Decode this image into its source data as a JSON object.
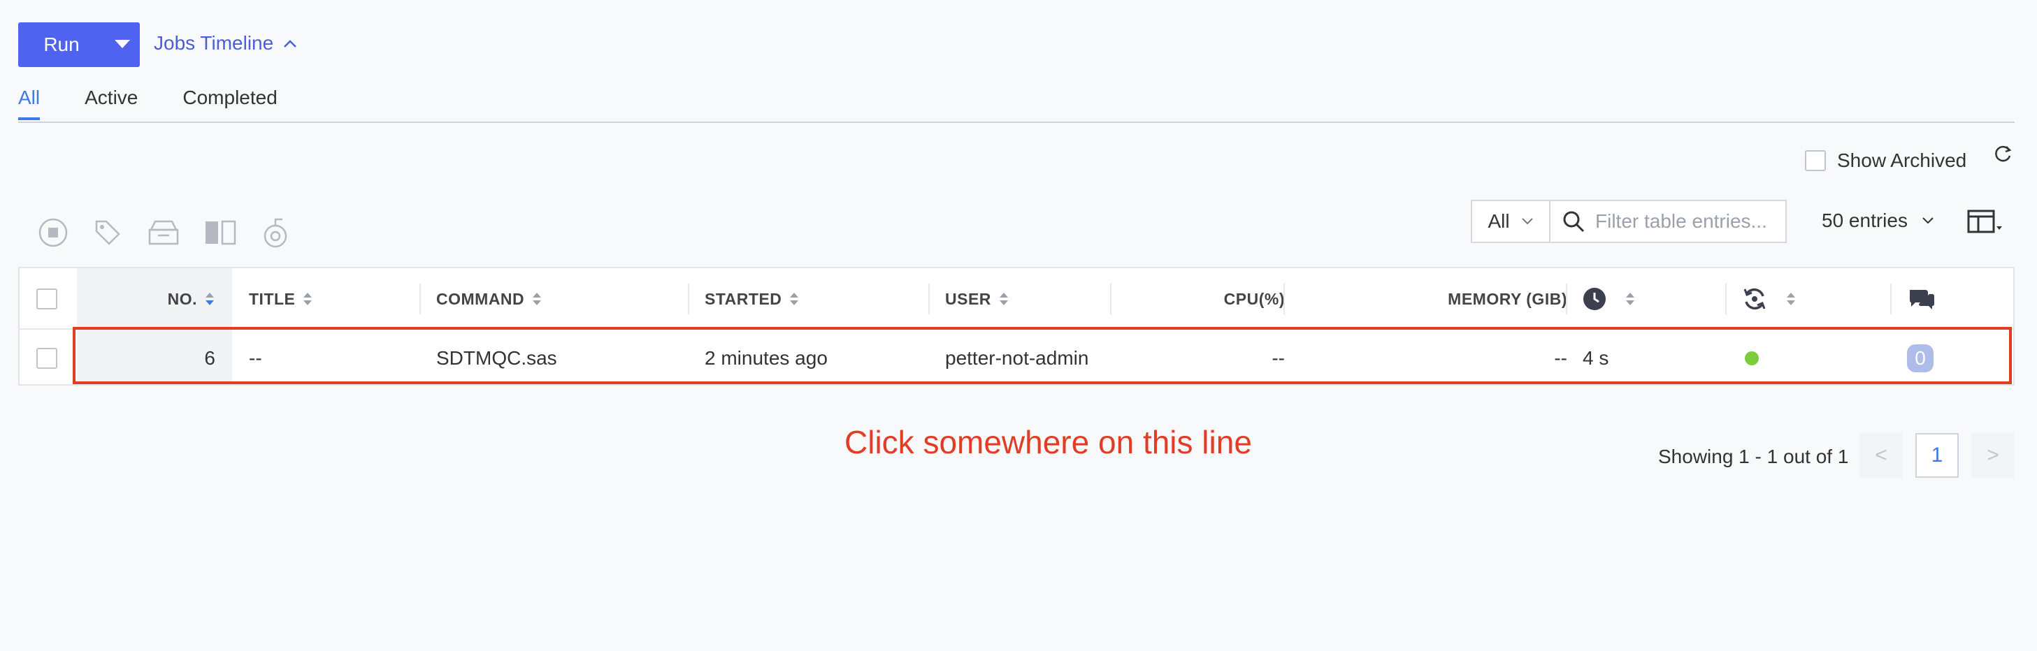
{
  "toolbar": {
    "run_label": "Run",
    "jobs_timeline_label": "Jobs Timeline"
  },
  "tabs": [
    {
      "label": "All",
      "active": true
    },
    {
      "label": "Active",
      "active": false
    },
    {
      "label": "Completed",
      "active": false
    }
  ],
  "show_archived": {
    "label": "Show Archived",
    "checked": false
  },
  "filter": {
    "scope_value": "All",
    "search_placeholder": "Filter table entries...",
    "entries_label": "50 entries"
  },
  "actions": {
    "icons": [
      "stop-icon",
      "tag-icon",
      "archive-icon",
      "compare-icon",
      "reset-icon"
    ]
  },
  "table": {
    "headers": {
      "no": "NO.",
      "title": "TITLE",
      "command": "COMMAND",
      "started": "STARTED",
      "user": "USER",
      "cpu": "CPU(%)",
      "memory": "MEMORY (GIB)"
    },
    "rows": [
      {
        "no": "6",
        "title": "--",
        "command": "SDTMQC.sas",
        "started": "2 minutes ago",
        "user": "petter-not-admin",
        "cpu": "--",
        "memory": "--",
        "duration": "4 s",
        "status_color": "#7ccc3c",
        "comments": "0"
      }
    ]
  },
  "annotation": {
    "text": "Click somewhere on this line",
    "color": "#e23c25"
  },
  "pagination": {
    "summary": "Showing 1 - 1 out of 1",
    "current_page": "1",
    "prev": "<",
    "next": ">"
  },
  "colors": {
    "accent": "#4f63f0",
    "link": "#3d7be0"
  }
}
